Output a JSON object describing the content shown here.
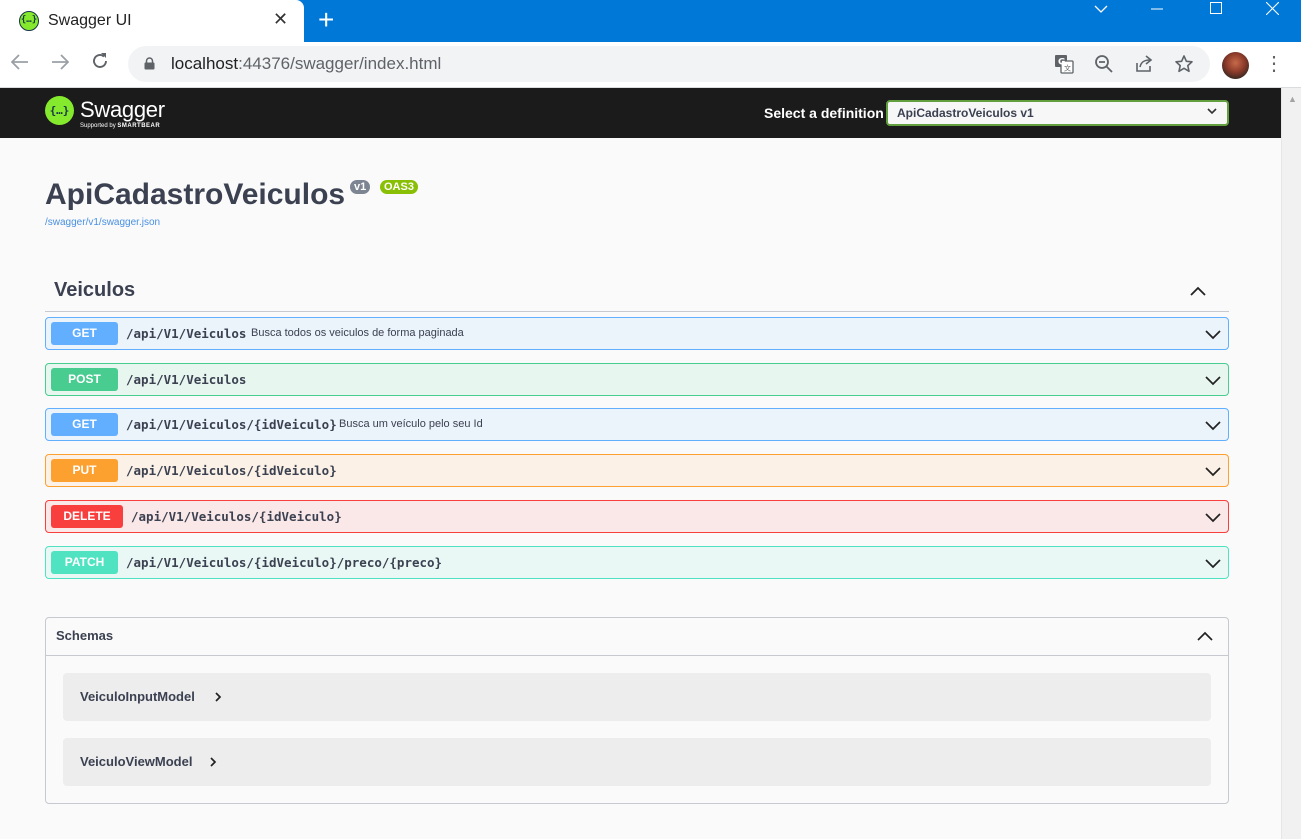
{
  "browser": {
    "tab_title": "Swagger UI",
    "url_host": "localhost",
    "url_rest": ":44376/swagger/index.html"
  },
  "topbar": {
    "logo_text": "Swagger",
    "logo_sub_prefix": "Supported by",
    "logo_sub_brand": "SMARTBEAR",
    "definition_label": "Select a definition",
    "definition_value": "ApiCadastroVeiculos v1"
  },
  "info": {
    "title": "ApiCadastroVeiculos",
    "version_badge": "v1",
    "oas_badge": "OAS3",
    "spec_link": "/swagger/v1/swagger.json"
  },
  "tag": {
    "name": "Veiculos",
    "operations": [
      {
        "method": "GET",
        "path": "/api/V1/Veiculos",
        "summary": "Busca todos os veiculos de forma paginada"
      },
      {
        "method": "POST",
        "path": "/api/V1/Veiculos",
        "summary": ""
      },
      {
        "method": "GET",
        "path": "/api/V1/Veiculos/{idVeiculo}",
        "summary": "Busca um veículo pelo seu Id"
      },
      {
        "method": "PUT",
        "path": "/api/V1/Veiculos/{idVeiculo}",
        "summary": ""
      },
      {
        "method": "DELETE",
        "path": "/api/V1/Veiculos/{idVeiculo}",
        "summary": ""
      },
      {
        "method": "PATCH",
        "path": "/api/V1/Veiculos/{idVeiculo}/preco/{preco}",
        "summary": ""
      }
    ]
  },
  "schemas": {
    "title": "Schemas",
    "models": [
      "VeiculoInputModel",
      "VeiculoViewModel"
    ]
  },
  "colors": {
    "get": "#61affe",
    "post": "#49cc90",
    "put": "#fca130",
    "delete": "#f93e3e",
    "patch": "#50e3c2",
    "swagger_green": "#85ea2d",
    "chrome_blue": "#0078d7"
  }
}
